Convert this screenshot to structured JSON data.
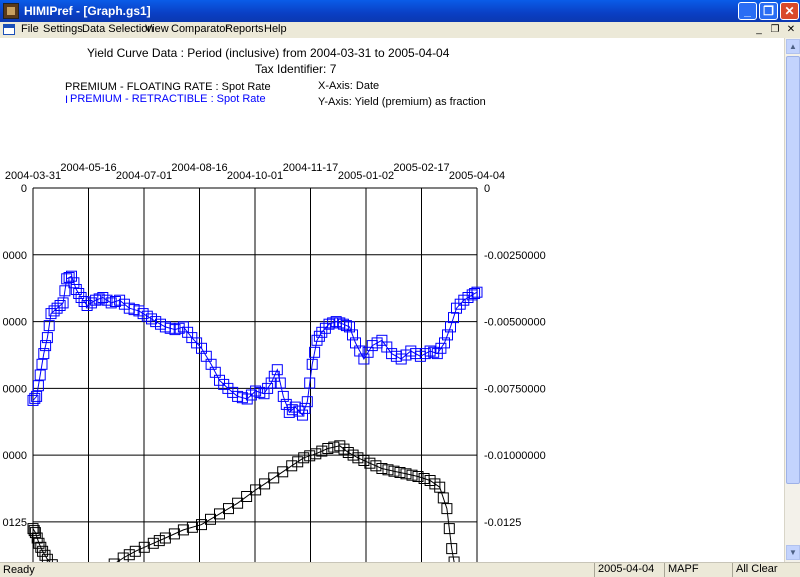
{
  "window": {
    "title": "HIMIPref - [Graph.gs1]",
    "minimize_glyph": "_",
    "maximize_glyph": "❐",
    "close_glyph": "✕"
  },
  "menubar": {
    "items": [
      "File",
      "Settings",
      "Data Selection",
      "View",
      "Comparator",
      "Reports",
      "Help"
    ],
    "mdi_minimize_glyph": "_",
    "mdi_restore_glyph": "❐",
    "mdi_close_glyph": "✕"
  },
  "chart_header": {
    "title_line1": "Yield Curve Data : Period (inclusive) from 2004-03-31 to 2005-04-04",
    "title_line2": "Tax Identifier: 7",
    "legend_series1": "PREMIUM - FLOATING RATE : Spot Rate",
    "legend_series2": "PREMIUM - RETRACTIBLE : Spot Rate",
    "legend_series2_prefix": "I",
    "x_axis_label": "X-Axis: Date",
    "y_axis_label": "Y-Axis: Yield (premium) as fraction"
  },
  "statusbar": {
    "ready": "Ready",
    "date": "2005-04-04",
    "code": "MAPF",
    "state": "All Clear"
  },
  "chart_data": {
    "type": "line",
    "x_ticks": [
      "2004-03-31",
      "2004-05-16",
      "2004-07-01",
      "2004-08-16",
      "2004-10-01",
      "2004-11-17",
      "2005-01-02",
      "2005-02-17",
      "2005-04-04"
    ],
    "y_left_ticks": [
      "0",
      "0000",
      "0000",
      "0000",
      "0000",
      "0125"
    ],
    "y_right_ticks": [
      "0",
      "-0.00250000",
      "-0.00500000",
      "-0.00750000",
      "-0.01000000",
      "-0.0125"
    ],
    "ylim": [
      -0.014,
      0
    ],
    "grid": true,
    "legend_position": "top-left",
    "series": [
      {
        "name": "PREMIUM - FLOATING RATE : Spot Rate",
        "color": "#000000",
        "points": [
          [
            0,
            -0.01275
          ],
          [
            2,
            -0.0129
          ],
          [
            5,
            -0.0133
          ],
          [
            8,
            -0.0136
          ],
          [
            12,
            -0.0139
          ],
          [
            20,
            -0.0143
          ],
          [
            40,
            -0.0145
          ],
          [
            60,
            -0.0143
          ],
          [
            75,
            -0.01385
          ],
          [
            85,
            -0.0136
          ],
          [
            100,
            -0.0133
          ],
          [
            110,
            -0.0131
          ],
          [
            125,
            -0.0128
          ],
          [
            140,
            -0.0126
          ],
          [
            155,
            -0.0122
          ],
          [
            170,
            -0.0118
          ],
          [
            185,
            -0.0113
          ],
          [
            200,
            -0.01085
          ],
          [
            215,
            -0.0104
          ],
          [
            225,
            -0.0101
          ],
          [
            235,
            -0.00995
          ],
          [
            245,
            -0.00975
          ],
          [
            255,
            -0.00965
          ],
          [
            262,
            -0.0099
          ],
          [
            270,
            -0.0101
          ],
          [
            280,
            -0.0103
          ],
          [
            290,
            -0.0105
          ],
          [
            300,
            -0.0106
          ],
          [
            310,
            -0.0107
          ],
          [
            320,
            -0.0108
          ],
          [
            330,
            -0.01095
          ],
          [
            338,
            -0.0112
          ],
          [
            344,
            -0.012
          ],
          [
            348,
            -0.0135
          ],
          [
            352,
            -0.0145
          ]
        ]
      },
      {
        "name": "PREMIUM - RETRACTIBLE : Spot Rate",
        "color": "#0000ff",
        "points": [
          [
            0,
            -0.00795
          ],
          [
            3,
            -0.0078
          ],
          [
            6,
            -0.007
          ],
          [
            9,
            -0.0062
          ],
          [
            12,
            -0.0056
          ],
          [
            15,
            -0.0047
          ],
          [
            20,
            -0.0045
          ],
          [
            25,
            -0.0043
          ],
          [
            28,
            -0.0034
          ],
          [
            32,
            -0.0033
          ],
          [
            36,
            -0.0038
          ],
          [
            40,
            -0.0041
          ],
          [
            45,
            -0.0044
          ],
          [
            52,
            -0.0042
          ],
          [
            58,
            -0.0041
          ],
          [
            65,
            -0.0043
          ],
          [
            72,
            -0.0042
          ],
          [
            80,
            -0.0045
          ],
          [
            88,
            -0.0046
          ],
          [
            95,
            -0.0048
          ],
          [
            102,
            -0.005
          ],
          [
            110,
            -0.0052
          ],
          [
            118,
            -0.0053
          ],
          [
            125,
            -0.0052
          ],
          [
            132,
            -0.0056
          ],
          [
            140,
            -0.006
          ],
          [
            148,
            -0.0066
          ],
          [
            155,
            -0.0072
          ],
          [
            162,
            -0.0075
          ],
          [
            170,
            -0.0078
          ],
          [
            178,
            -0.0079
          ],
          [
            185,
            -0.0076
          ],
          [
            192,
            -0.0077
          ],
          [
            198,
            -0.0073
          ],
          [
            203,
            -0.0068
          ],
          [
            208,
            -0.0078
          ],
          [
            213,
            -0.0084
          ],
          [
            218,
            -0.0082
          ],
          [
            224,
            -0.0085
          ],
          [
            228,
            -0.008
          ],
          [
            232,
            -0.0066
          ],
          [
            236,
            -0.0057
          ],
          [
            240,
            -0.0054
          ],
          [
            246,
            -0.0051
          ],
          [
            252,
            -0.005
          ],
          [
            258,
            -0.0051
          ],
          [
            263,
            -0.0052
          ],
          [
            268,
            -0.0058
          ],
          [
            275,
            -0.0064
          ],
          [
            282,
            -0.0059
          ],
          [
            290,
            -0.0057
          ],
          [
            298,
            -0.0062
          ],
          [
            306,
            -0.0064
          ],
          [
            314,
            -0.0061
          ],
          [
            322,
            -0.0063
          ],
          [
            330,
            -0.0061
          ],
          [
            336,
            -0.0062
          ],
          [
            342,
            -0.0058
          ],
          [
            347,
            -0.0052
          ],
          [
            352,
            -0.0045
          ],
          [
            358,
            -0.0042
          ],
          [
            365,
            -0.004
          ],
          [
            369,
            -0.0039
          ]
        ]
      }
    ]
  }
}
